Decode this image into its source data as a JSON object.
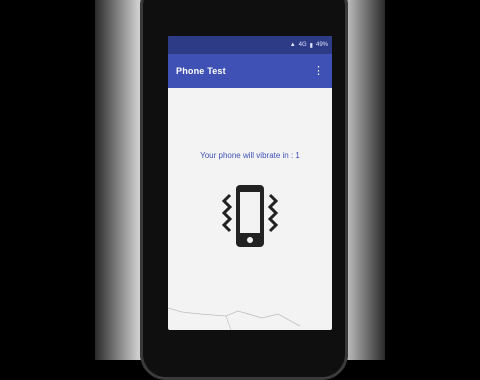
{
  "status_bar": {
    "network": "4G",
    "battery": "49%"
  },
  "app_bar": {
    "title": "Phone Test",
    "menu_icon": "overflow-menu-icon"
  },
  "main": {
    "message": "Your phone will vibrate in : 1",
    "icon": "phone-vibrate-icon"
  },
  "colors": {
    "app_bar": "#3f51b5",
    "status_bar": "#2d3b86",
    "message_text": "#3f51b5",
    "screen_bg": "#f3f3f4"
  }
}
